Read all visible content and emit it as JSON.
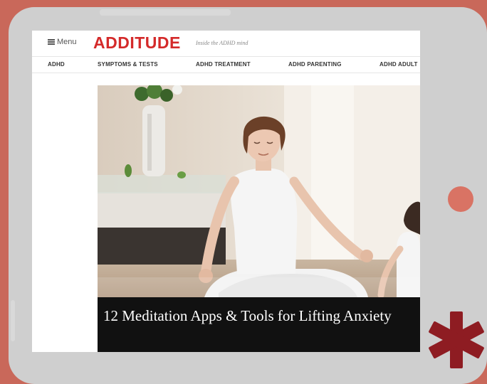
{
  "header": {
    "menu_label": "Menu",
    "logo_text": "ADDITUDE",
    "tagline": "Inside the ADHD mind"
  },
  "nav": {
    "items": [
      {
        "label": "ADHD"
      },
      {
        "label": "SYMPTOMS & TESTS"
      },
      {
        "label": "ADHD TREATMENT"
      },
      {
        "label": "ADHD PARENTING"
      },
      {
        "label": "ADHD ADULT"
      }
    ]
  },
  "article": {
    "title": "12 Meditation Apps & Tools for Lifting Anxiety"
  },
  "colors": {
    "background": "#c9685a",
    "brand_red": "#d42a2a",
    "asterisk": "#8e1c22",
    "home_button": "#d97364"
  },
  "icons": {
    "menu": "hamburger-icon",
    "decoration": "asterisk-icon"
  }
}
